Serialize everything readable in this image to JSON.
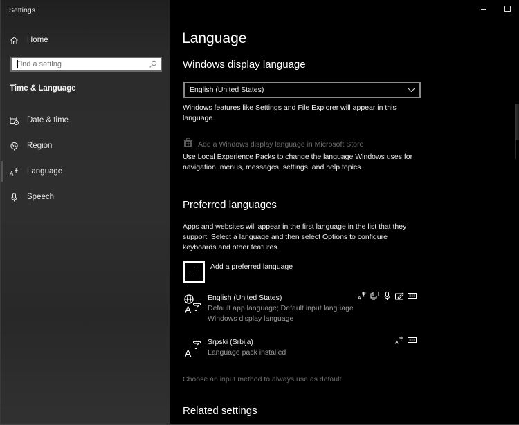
{
  "window": {
    "title": "Settings",
    "minimize_icon": "minimize-icon",
    "maximize_icon": "maximize-icon"
  },
  "sidebar": {
    "home_label": "Home",
    "search": {
      "placeholder": "Find a setting",
      "value": ""
    },
    "section_title": "Time & Language",
    "items": [
      {
        "label": "Date & time",
        "icon": "calendar-clock-icon",
        "active": false
      },
      {
        "label": "Region",
        "icon": "globe-icon",
        "active": false
      },
      {
        "label": "Language",
        "icon": "language-icon",
        "active": true
      },
      {
        "label": "Speech",
        "icon": "microphone-icon",
        "active": false
      }
    ]
  },
  "main": {
    "title": "Language",
    "display_language": {
      "heading": "Windows display language",
      "selected": "English (United States)",
      "description": "Windows features like Settings and File Explorer will appear in this language.",
      "store_link": "Add a Windows display language in Microsoft Store",
      "lxp_description": "Use Local Experience Packs to change the language Windows uses for navigation, menus, messages, settings, and help topics."
    },
    "preferred": {
      "heading": "Preferred languages",
      "description": "Apps and websites will appear in the first language in the list that they support. Select a language and then select Options to configure keyboards and other features.",
      "add_label": "Add a preferred language",
      "languages": [
        {
          "name": "English (United States)",
          "details": [
            "Default app language; Default input language",
            "Windows display language"
          ],
          "features": [
            "language-pack-icon",
            "display-language-icon",
            "speech-icon",
            "handwriting-icon",
            "keyboard-icon"
          ]
        },
        {
          "name": "Srpski (Srbija)",
          "details": [
            "Language pack installed"
          ],
          "features": [
            "language-pack-icon",
            "keyboard-icon"
          ]
        }
      ],
      "input_method_link": "Choose an input method to always use as default"
    },
    "related_heading": "Related settings"
  }
}
